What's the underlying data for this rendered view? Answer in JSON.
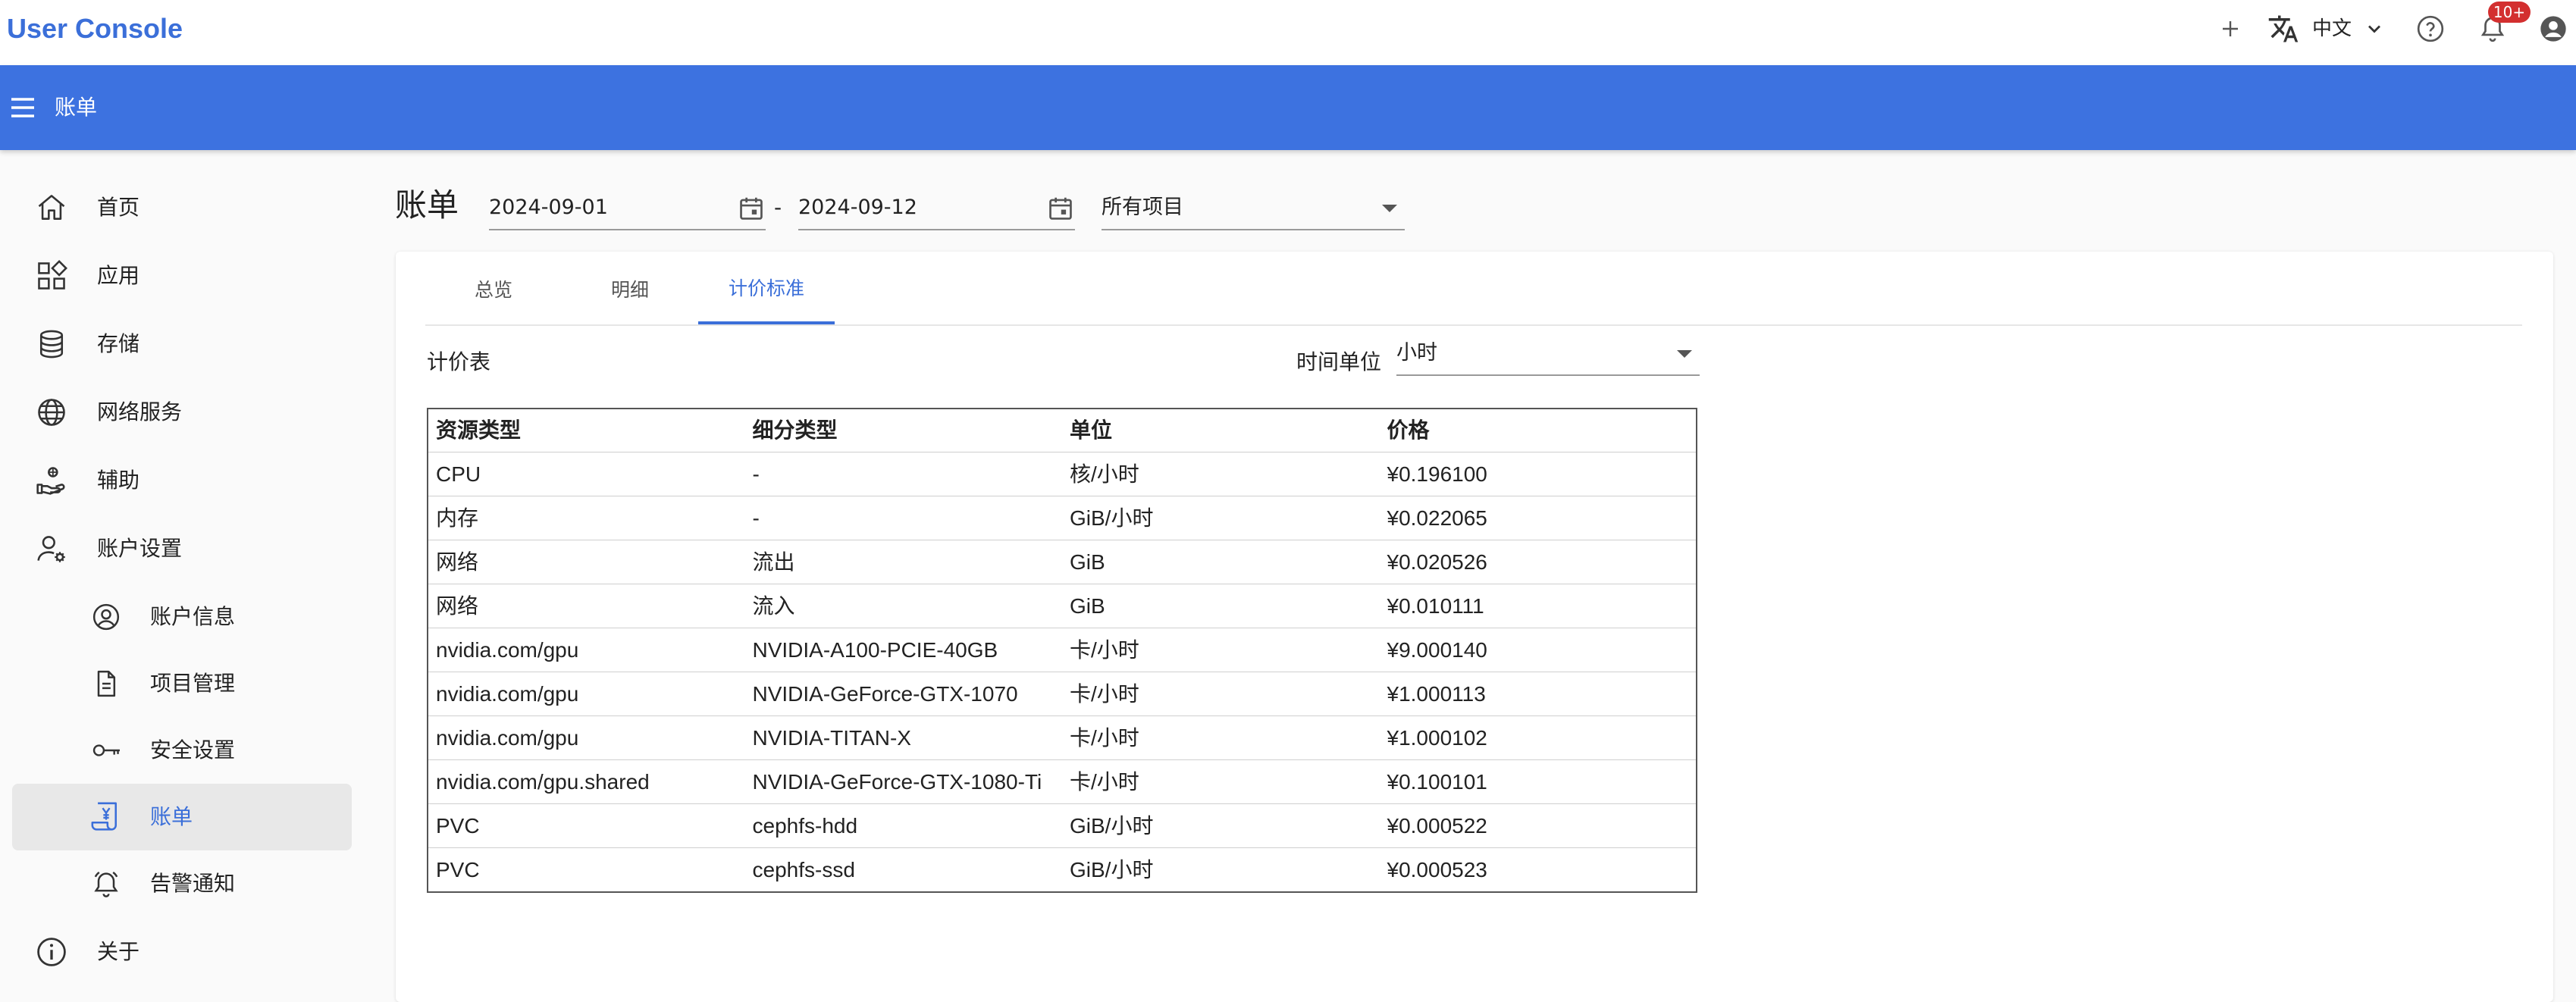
{
  "header": {
    "app_title": "User Console",
    "language": "中文",
    "notification_badge": "10+"
  },
  "appbar": {
    "breadcrumb": "账单"
  },
  "sidebar": {
    "items": [
      {
        "label": "首页",
        "icon": "home-icon"
      },
      {
        "label": "应用",
        "icon": "apps-icon"
      },
      {
        "label": "存储",
        "icon": "database-icon"
      },
      {
        "label": "网络服务",
        "icon": "globe-icon"
      },
      {
        "label": "辅助",
        "icon": "helper-icon"
      },
      {
        "label": "账户设置",
        "icon": "user-settings-icon"
      },
      {
        "label": "账户信息",
        "icon": "account-circle-icon"
      },
      {
        "label": "项目管理",
        "icon": "document-icon"
      },
      {
        "label": "安全设置",
        "icon": "key-icon"
      },
      {
        "label": "账单",
        "icon": "bill-icon",
        "active": true
      },
      {
        "label": "告警通知",
        "icon": "alarm-bell-icon"
      },
      {
        "label": "关于",
        "icon": "info-icon"
      }
    ]
  },
  "main": {
    "title": "账单",
    "start_date": "2024-09-01",
    "date_separator": "-",
    "end_date": "2024-09-12",
    "project_filter": "所有项目",
    "tabs": [
      {
        "label": "总览"
      },
      {
        "label": "明细"
      },
      {
        "label": "计价标准",
        "active": true
      }
    ],
    "section_label": "计价表",
    "time_unit_label": "时间单位",
    "time_unit_value": "小时",
    "table": {
      "headers": [
        "资源类型",
        "细分类型",
        "单位",
        "价格"
      ],
      "rows": [
        [
          "CPU",
          "-",
          "核/小时",
          "¥0.196100"
        ],
        [
          "内存",
          "-",
          "GiB/小时",
          "¥0.022065"
        ],
        [
          "网络",
          "流出",
          "GiB",
          "¥0.020526"
        ],
        [
          "网络",
          "流入",
          "GiB",
          "¥0.010111"
        ],
        [
          "nvidia.com/gpu",
          "NVIDIA-A100-PCIE-40GB",
          "卡/小时",
          "¥9.000140"
        ],
        [
          "nvidia.com/gpu",
          "NVIDIA-GeForce-GTX-1070",
          "卡/小时",
          "¥1.000113"
        ],
        [
          "nvidia.com/gpu",
          "NVIDIA-TITAN-X",
          "卡/小时",
          "¥1.000102"
        ],
        [
          "nvidia.com/gpu.shared",
          "NVIDIA-GeForce-GTX-1080-Ti",
          "卡/小时",
          "¥0.100101"
        ],
        [
          "PVC",
          "cephfs-hdd",
          "GiB/小时",
          "¥0.000522"
        ],
        [
          "PVC",
          "cephfs-ssd",
          "GiB/小时",
          "¥0.000523"
        ]
      ]
    }
  },
  "colors": {
    "accent": "#3b6fd9",
    "appbar": "#3d72e0",
    "badge": "#d32f2f"
  }
}
